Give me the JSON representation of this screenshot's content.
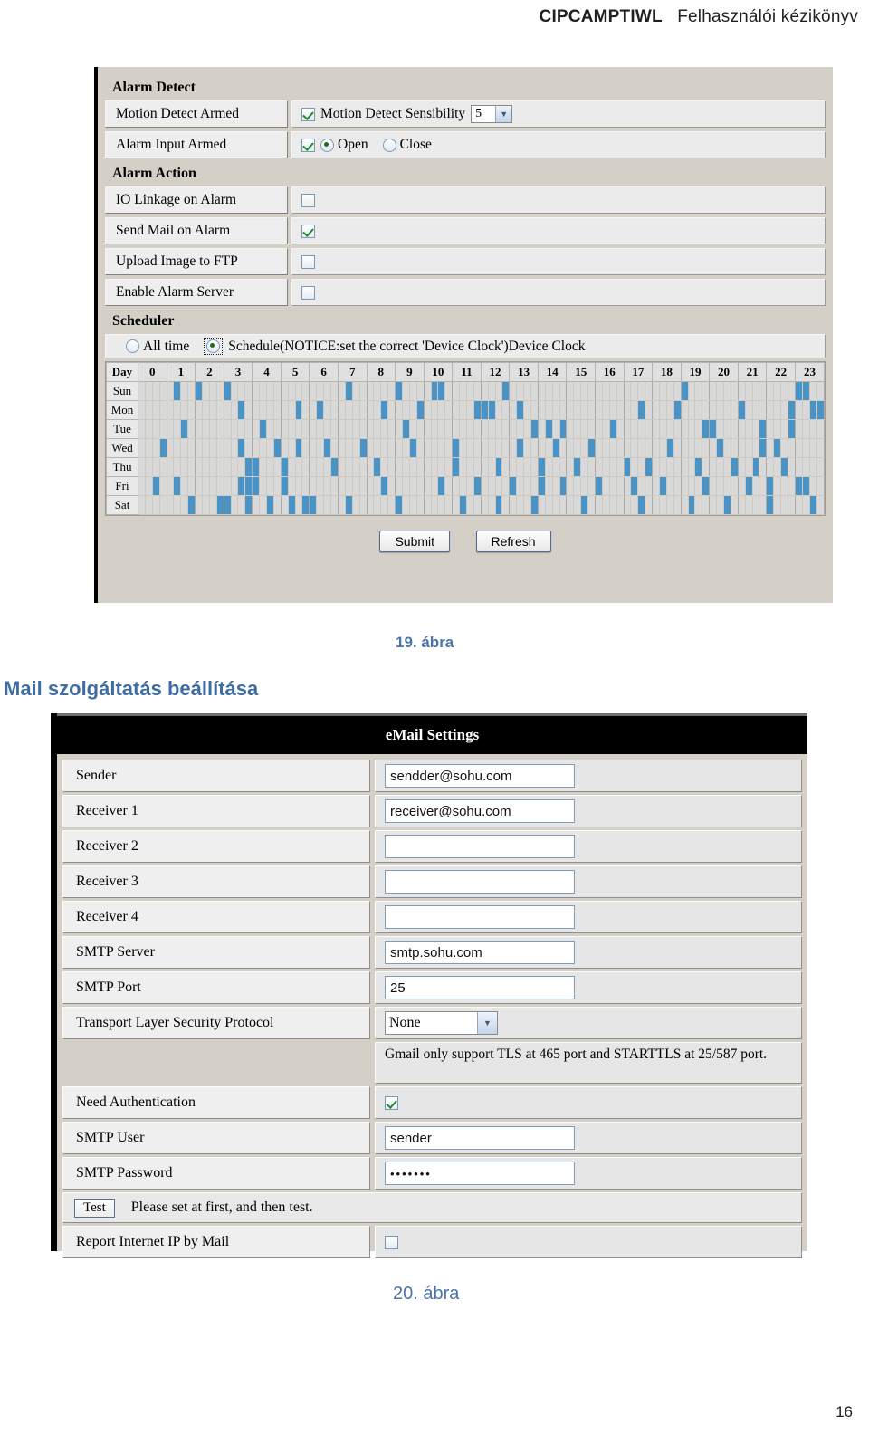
{
  "header": {
    "model": "CIPCAMPTIWL",
    "title": "Felhasználói kézikönyv"
  },
  "figure19": {
    "caption": "19. ábra",
    "alarm_detect": {
      "section_title": "Alarm Detect",
      "rows": [
        {
          "label": "Motion Detect Armed",
          "checkbox_checked": true,
          "value_label": "Motion Detect Sensibility",
          "select_value": "5"
        },
        {
          "label": "Alarm Input Armed",
          "checkbox_checked": true,
          "radio_open": "Open",
          "radio_close": "Close",
          "radio_selected": "Open"
        }
      ]
    },
    "alarm_action": {
      "section_title": "Alarm Action",
      "rows": [
        {
          "label": "IO Linkage on Alarm",
          "checked": false
        },
        {
          "label": "Send Mail on Alarm",
          "checked": true
        },
        {
          "label": "Upload Image to FTP",
          "checked": false
        },
        {
          "label": "Enable Alarm Server",
          "checked": false
        }
      ]
    },
    "scheduler": {
      "section_title": "Scheduler",
      "mode_all_time": "All time",
      "mode_schedule": "Schedule(NOTICE:set the correct 'Device Clock')Device Clock",
      "mode_selected": "schedule",
      "day_header": "Day",
      "hours": [
        "0",
        "1",
        "2",
        "3",
        "4",
        "5",
        "6",
        "7",
        "8",
        "9",
        "10",
        "11",
        "12",
        "13",
        "14",
        "15",
        "16",
        "17",
        "18",
        "19",
        "20",
        "21",
        "22",
        "23"
      ],
      "days": [
        "Sun",
        "Mon",
        "Tue",
        "Wed",
        "Thu",
        "Fri",
        "Sat"
      ],
      "slots_per_hour": 4,
      "selected_slots": {
        "Sun": [
          5,
          8,
          12,
          29,
          36,
          41,
          42,
          51,
          76,
          92,
          93
        ],
        "Mon": [
          14,
          25,
          34,
          39,
          47,
          48,
          49,
          53,
          22,
          70,
          75,
          84,
          91,
          94,
          95
        ],
        "Tue": [
          6,
          17,
          37,
          55,
          57,
          59,
          66,
          79,
          80,
          87,
          91
        ],
        "Wed": [
          3,
          14,
          19,
          22,
          26,
          31,
          38,
          44,
          53,
          58,
          63,
          74,
          81,
          87,
          89
        ],
        "Thu": [
          15,
          16,
          20,
          27,
          33,
          44,
          50,
          56,
          61,
          68,
          71,
          78,
          83,
          86,
          90
        ],
        "Fri": [
          2,
          5,
          14,
          15,
          16,
          20,
          34,
          42,
          47,
          52,
          56,
          59,
          64,
          69,
          73,
          79,
          85,
          88,
          92,
          93
        ],
        "Sat": [
          7,
          11,
          12,
          15,
          18,
          21,
          23,
          24,
          29,
          36,
          45,
          50,
          55,
          62,
          70,
          77,
          82,
          88,
          94
        ]
      },
      "submit_label": "Submit",
      "refresh_label": "Refresh"
    }
  },
  "section_heading": "Mail szolgáltatás beállítása",
  "figure20": {
    "caption": "20. ábra",
    "title": "eMail Settings",
    "rows": [
      {
        "label": "Sender",
        "type": "text",
        "value": "sendder@sohu.com"
      },
      {
        "label": "Receiver 1",
        "type": "text",
        "value": "receiver@sohu.com"
      },
      {
        "label": "Receiver 2",
        "type": "text",
        "value": ""
      },
      {
        "label": "Receiver 3",
        "type": "text",
        "value": ""
      },
      {
        "label": "Receiver 4",
        "type": "text",
        "value": ""
      },
      {
        "label": "SMTP Server",
        "type": "text",
        "value": "smtp.sohu.com"
      },
      {
        "label": "SMTP Port",
        "type": "text",
        "value": "25"
      },
      {
        "label": "Transport Layer Security Protocol",
        "type": "select",
        "value": "None"
      }
    ],
    "note": "Gmail only support TLS at 465 port and STARTTLS at 25/587 port.",
    "auth_row": {
      "label": "Need Authentication",
      "checked": true
    },
    "user_row": {
      "label": "SMTP User",
      "value": "sender"
    },
    "password_row": {
      "label": "SMTP Password",
      "value": "•••••••"
    },
    "test_row": {
      "button": "Test",
      "note": "Please set at first, and then test."
    },
    "report_row": {
      "label": "Report Internet IP by Mail",
      "checked": false
    }
  },
  "page_number": "16"
}
